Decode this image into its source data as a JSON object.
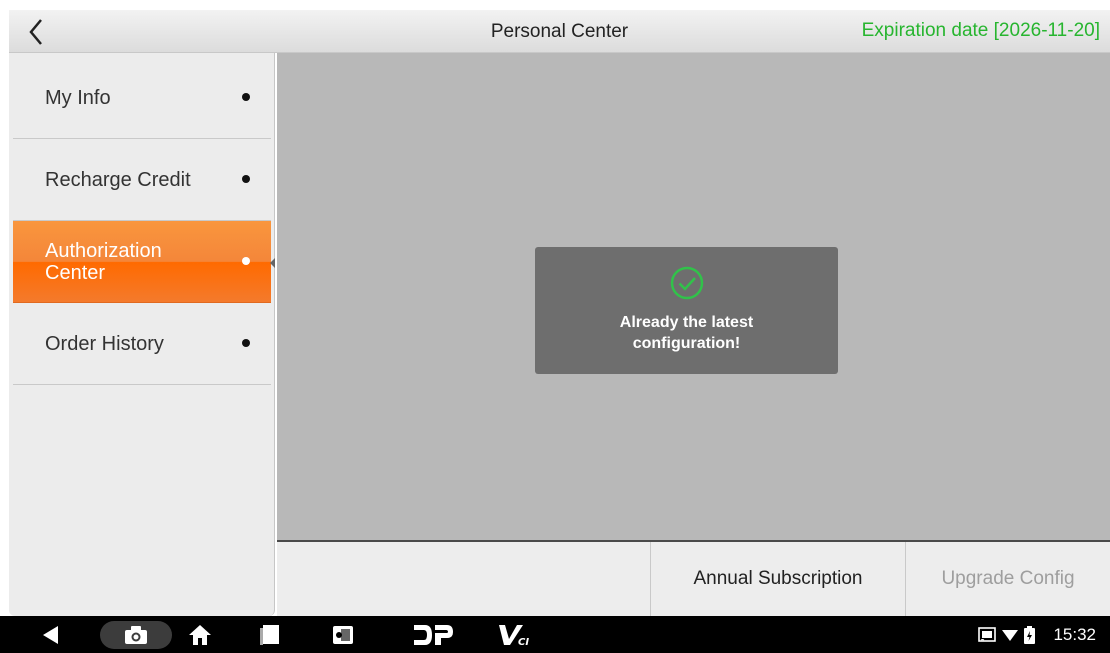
{
  "header": {
    "title": "Personal Center",
    "expiration": "Expiration date [2026-11-20]",
    "back_icon": "chevron-left-icon"
  },
  "sidebar": {
    "items": [
      {
        "label": "My Info"
      },
      {
        "label": "Recharge Credit"
      },
      {
        "label": "Authorization Center",
        "active": true
      },
      {
        "label": "Order History"
      }
    ]
  },
  "toast": {
    "icon": "check-circle-icon",
    "line1": "Already the latest",
    "line2": "configuration!"
  },
  "actions": {
    "annual_subscription": "Annual Subscription",
    "upgrade_config": "Upgrade Config"
  },
  "statusbar": {
    "time": "15:32"
  },
  "colors": {
    "accent_orange": "#f47a2c",
    "expiry_green": "#27b52f",
    "toast_bg": "#6e6e6e",
    "check_green": "#31c24a"
  }
}
